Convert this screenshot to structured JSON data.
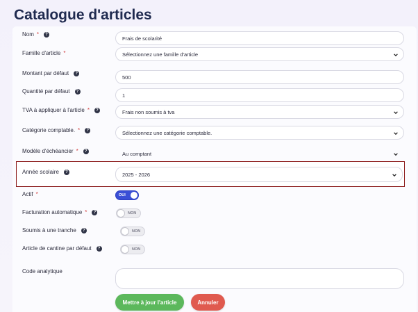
{
  "page": {
    "title": "Catalogue d'articles"
  },
  "form": {
    "nom": {
      "label": "Nom",
      "value": "Frais de scolarité"
    },
    "famille": {
      "label": "Famille d'article",
      "value": "Sélectionnez une famille d'article"
    },
    "montant": {
      "label": "Montant par défaut",
      "value": "500"
    },
    "quantite": {
      "label": "Quantité par défaut",
      "value": "1"
    },
    "tva": {
      "label": "TVA à appliquer à l'article",
      "value": "Frais non soumis à tva"
    },
    "categorie": {
      "label": "Catégorie comptable.",
      "value": "Sélectionnez une catégorie comptable."
    },
    "echeancier": {
      "label": "Modèle d'échéancier",
      "value": "Au comptant"
    },
    "annee": {
      "label": "Année scolaire",
      "value": "2025 - 2026"
    },
    "actif": {
      "label": "Actif",
      "state": "OUI"
    },
    "facturation": {
      "label": "Facturation automatique",
      "state": "NON"
    },
    "tranche": {
      "label": "Soumis à une tranche",
      "state": "NON"
    },
    "cantine": {
      "label": "Article de cantine par défaut",
      "state": "NON"
    },
    "code": {
      "label": "Code analytique",
      "value": ""
    }
  },
  "buttons": {
    "save": "Mettre à jour l'article",
    "cancel": "Annuler"
  },
  "colors": {
    "accent": "#3a4fd6",
    "save": "#5cb85c",
    "cancel": "#e05a4f",
    "highlight": "#8b1a1a"
  }
}
